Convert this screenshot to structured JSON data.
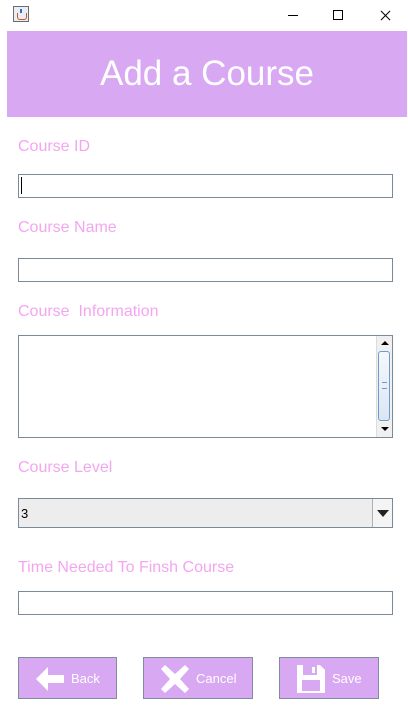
{
  "window": {
    "icon": "java-cup-icon",
    "controls": [
      "minimize-icon",
      "maximize-icon",
      "close-icon"
    ]
  },
  "header": {
    "title": "Add a Course",
    "background_color": "#d8a8f3",
    "text_color": "#ffffff"
  },
  "form": {
    "label_color": "#f3a6f0",
    "course_id": {
      "label": "Course ID",
      "value": ""
    },
    "course_name": {
      "label": "Course Name",
      "value": ""
    },
    "course_information": {
      "label": "Course  Information",
      "value": ""
    },
    "course_level": {
      "label": "Course Level",
      "selected": "3"
    },
    "time_needed": {
      "label": "Time Needed To Finsh Course",
      "value": ""
    }
  },
  "buttons": {
    "back": {
      "label": "Back",
      "icon": "arrow-left-icon"
    },
    "cancel": {
      "label": "Cancel",
      "icon": "x-icon"
    },
    "save": {
      "label": "Save",
      "icon": "floppy-disk-icon"
    }
  }
}
